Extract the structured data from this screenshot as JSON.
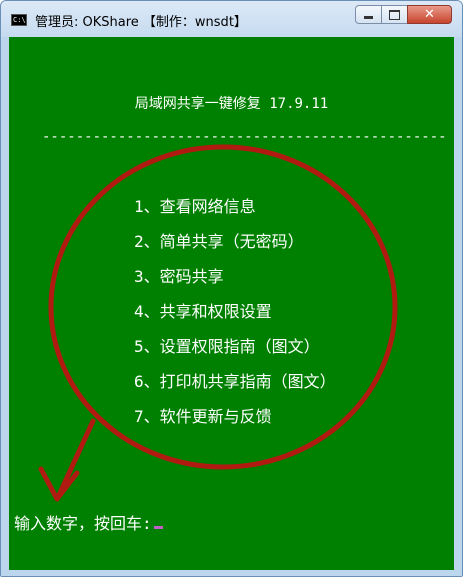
{
  "window": {
    "title": "管理员:  OKShare 【制作：wnsdt】",
    "icon_label": "C:\\",
    "buttons": {
      "minimize": "minimize-icon",
      "maximize": "maximize-icon",
      "close": "close-icon"
    }
  },
  "console": {
    "heading": "局域网共享一键修复 17.9.11",
    "rule": "------------------------------------------------",
    "menu_items": [
      "1、查看网络信息",
      "2、简单共享（无密码）",
      "3、密码共享",
      "4、共享和权限设置",
      "5、设置权限指南（图文）",
      "6、打印机共享指南（图文）",
      "7、软件更新与反馈"
    ],
    "prompt": "输入数字，按回车:"
  },
  "colors": {
    "console_bg": "#008000",
    "console_text": "#ffffff",
    "annotation": "#b01a10",
    "cursor": "#c060c8"
  }
}
